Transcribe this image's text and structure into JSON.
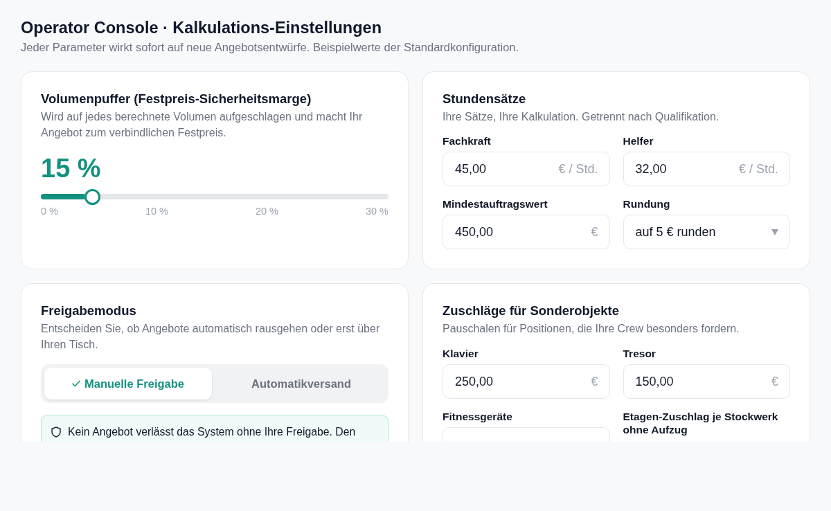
{
  "header": {
    "title": "Operator Console · Kalkulations-Einstellungen",
    "subtitle": "Jeder Parameter wirkt sofort auf neue Angebotsentwürfe. Beispielwerte der Standardkonfiguration."
  },
  "cards": [
    {
      "kind": "slider",
      "title": "Volumenpuffer (Festpreis-Sicherheitsmarge)",
      "description": "Wird auf jedes berechnete Volumen aufgeschlagen und macht Ihr Angebot zum verbindlichen Festpreis.",
      "value": "15 %",
      "level": 0.15,
      "ticks": [
        "0 %",
        "10 %",
        "20 %",
        "30 %"
      ]
    },
    {
      "kind": "fields",
      "title": "Stundensätze",
      "description": "Ihre Sätze, Ihre Kalkulation. Getrennt nach Qualifikation.",
      "fields": [
        {
          "kind": "input",
          "label": "Fachkraft",
          "value": "45,00",
          "unit": "€ / Std."
        },
        {
          "kind": "input",
          "label": "Helfer",
          "value": "32,00",
          "unit": "€ / Std."
        },
        {
          "kind": "input",
          "label": "Mindestauftragswert",
          "value": "450,00",
          "unit": "€"
        },
        {
          "kind": "select",
          "label": "Rundung",
          "value": "auf 5 € runden"
        }
      ]
    },
    {
      "kind": "mode",
      "title": "Freigabemodus",
      "description": "Entscheiden Sie, ob Angebote automatisch rausgehen oder erst über Ihren Tisch.",
      "options": [
        {
          "label": "Manuelle Freigabe",
          "selected": true
        },
        {
          "label": "Automatikversand",
          "selected": false
        }
      ],
      "notice": "Kein Angebot verlässt das System ohne Ihre Freigabe. Den"
    },
    {
      "kind": "fields",
      "title": "Zuschläge für Sonderobjekte",
      "description": "Pauschalen für Positionen, die Ihre Crew besonders fordern.",
      "fields": [
        {
          "kind": "input",
          "label": "Klavier",
          "value": "250,00",
          "unit": "€"
        },
        {
          "kind": "input",
          "label": "Tresor",
          "value": "150,00",
          "unit": "€"
        },
        {
          "kind": "input",
          "label": "Fitnessgeräte"
        },
        {
          "kind": "label",
          "label": "Etagen-Zuschlag je Stockwerk ohne Aufzug"
        }
      ]
    }
  ]
}
